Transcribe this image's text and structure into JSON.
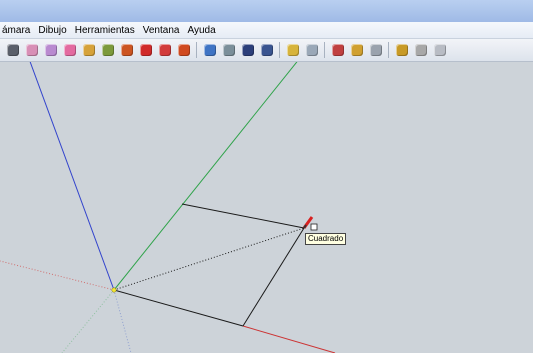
{
  "menu": {
    "items": [
      {
        "label": "ámara"
      },
      {
        "label": "Dibujo"
      },
      {
        "label": "Herramientas"
      },
      {
        "label": "Ventana"
      },
      {
        "label": "Ayuda"
      }
    ]
  },
  "toolbar": {
    "tools": [
      {
        "name": "arc-icon",
        "color": "#5a5f6a"
      },
      {
        "name": "eraser-icon",
        "color": "#d88fb6"
      },
      {
        "name": "paint-bucket-icon",
        "color": "#b98ad0"
      },
      {
        "name": "eraser-pink-icon",
        "color": "#e36aa0"
      },
      {
        "name": "tape-measure-icon",
        "color": "#d6a23a"
      },
      {
        "name": "protractor-icon",
        "color": "#7c9a3c"
      },
      {
        "name": "push-pull-icon",
        "color": "#cc5522"
      },
      {
        "name": "move-icon",
        "color": "#d02a2a"
      },
      {
        "name": "rotate-icon",
        "color": "#d23b3b"
      },
      {
        "name": "follow-me-icon",
        "color": "#d04a20"
      },
      {
        "name": "orbit-icon",
        "color": "#3f74c4"
      },
      {
        "name": "pan-icon",
        "color": "#7b8f9a"
      },
      {
        "name": "zoom-icon",
        "color": "#2c3f7a"
      },
      {
        "name": "zoom-extents-icon",
        "color": "#3a5590"
      },
      {
        "name": "get-models-icon",
        "color": "#d7b43c"
      },
      {
        "name": "share-model-icon",
        "color": "#9aa8b8"
      },
      {
        "name": "component-icon",
        "color": "#c04040"
      },
      {
        "name": "person-icon",
        "color": "#d0a030"
      },
      {
        "name": "sphere-icon",
        "color": "#9aa2ad"
      },
      {
        "name": "warehouse-icon",
        "color": "#c89a26"
      },
      {
        "name": "material-icon",
        "color": "#a8a8a8"
      },
      {
        "name": "style-icon",
        "color": "#b8bcc4"
      }
    ]
  },
  "tooltip": {
    "label": "Cuadrado"
  },
  "colors": {
    "viewport_bg": "#cdd3d9",
    "axis_blue": "#3344cc",
    "axis_green": "#2fa34a",
    "axis_red": "#cc3333",
    "edge": "#1a1a1a",
    "inference_dot": "#f2e630"
  }
}
